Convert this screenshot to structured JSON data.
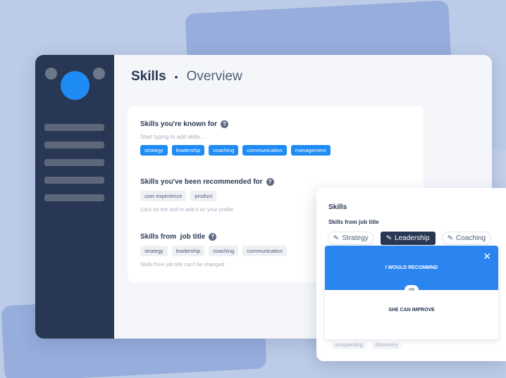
{
  "header": {
    "title": "Skills",
    "separator": "•",
    "subtitle": "Overview"
  },
  "known_for": {
    "title": "Skills you're known for",
    "placeholder": "Start typing to add skills....",
    "chips": [
      "strategy",
      "leadership",
      "coaching",
      "communication",
      "management"
    ]
  },
  "recommended": {
    "title": "Skills you've been recommended for",
    "chips": [
      "user experience",
      "product"
    ],
    "hint": "Click on the skill to add it on your profile"
  },
  "job_title": {
    "title": "Skills from  job title",
    "chips": [
      "strategy",
      "leadership",
      "coaching",
      "communication"
    ],
    "hint": "Skills from job title can't be changed"
  },
  "panel": {
    "title": "Skills",
    "subtitle": "Skills from job title",
    "tabs": [
      "Strategy",
      "Leadership",
      "Coaching"
    ],
    "active_tab": "Leadership",
    "recommend_label": "I WOULD RECOMMND",
    "or_label": "OR",
    "improve_label": "SHE CAN IMPROVE",
    "faded_chips": [
      "prospecting",
      "discovery"
    ]
  },
  "colors": {
    "accent": "#1f8bf5",
    "sidebar": "#283753",
    "background": "#bccbe7"
  }
}
